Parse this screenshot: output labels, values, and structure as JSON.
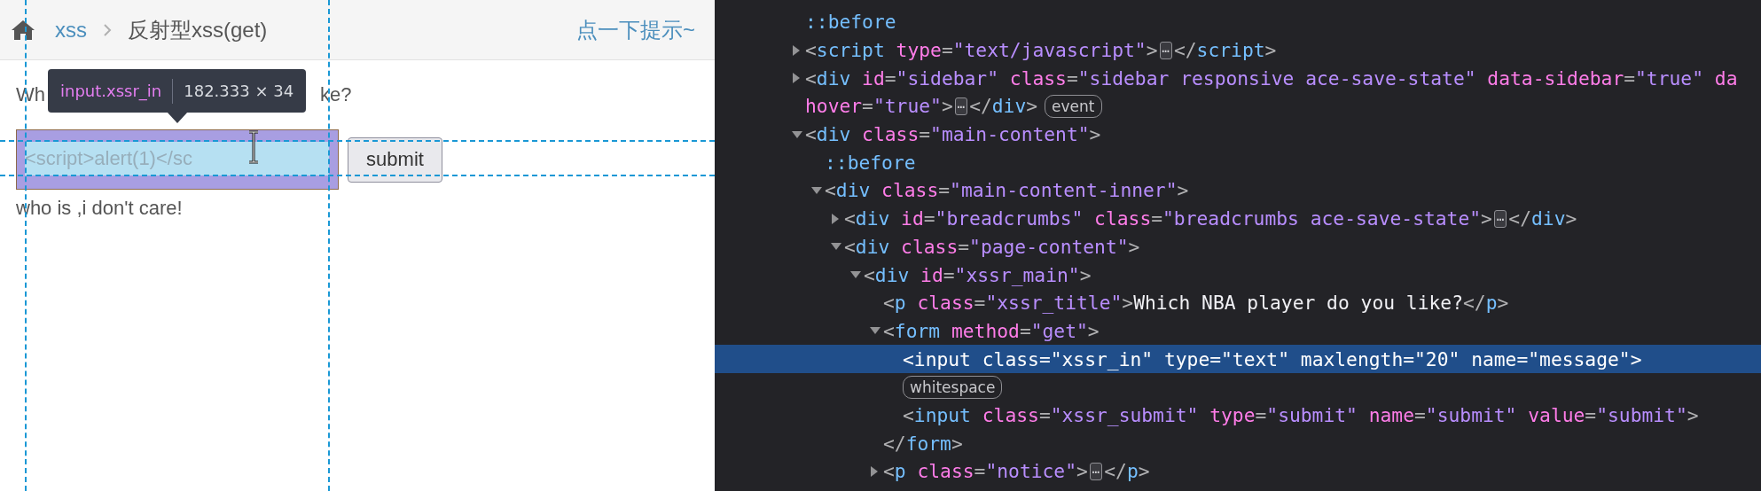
{
  "breadcrumbs": {
    "items": [
      {
        "kind": "link",
        "text": "xss"
      },
      {
        "kind": "current",
        "text": "反射型xss(get)"
      }
    ],
    "hint_link": "点一下提示~"
  },
  "page": {
    "question_visible": [
      "Wh",
      "ke?"
    ],
    "input_value": "<script>alert(1)</sc",
    "submit_label": "submit",
    "result_text": "who is ,i don't care!"
  },
  "inspector_tooltip": {
    "selector": "input.xssr_in",
    "size": "182.333 × 34"
  },
  "devtools": {
    "nodes": [
      {
        "kind": "pseudo",
        "selected": false,
        "lines": [
          [
            {
              "kind": "pseudo",
              "text": "::before"
            }
          ]
        ]
      },
      {
        "kind": "branch",
        "expanded": false,
        "selected": false,
        "lines": [
          [
            {
              "kind": "punct",
              "text": "<"
            },
            {
              "kind": "tag",
              "text": "script"
            },
            {
              "kind": "attr",
              "text": " type"
            },
            {
              "kind": "punct",
              "text": "="
            },
            {
              "kind": "value",
              "text": "\"text/javascript\""
            },
            {
              "kind": "punct",
              "text": ">"
            },
            {
              "kind": "more",
              "text": "⋯"
            },
            {
              "kind": "punct",
              "text": "</"
            },
            {
              "kind": "tag",
              "text": "script"
            },
            {
              "kind": "punct",
              "text": ">"
            }
          ]
        ]
      },
      {
        "kind": "branch",
        "expanded": false,
        "selected": false,
        "lines": [
          [
            {
              "kind": "punct",
              "text": "<"
            },
            {
              "kind": "tag",
              "text": "div"
            },
            {
              "kind": "attr",
              "text": " id"
            },
            {
              "kind": "punct",
              "text": "="
            },
            {
              "kind": "value",
              "text": "\"sidebar\""
            },
            {
              "kind": "attr",
              "text": " class"
            },
            {
              "kind": "punct",
              "text": "="
            },
            {
              "kind": "value",
              "text": "\"sidebar responsive ace-save-state\""
            },
            {
              "kind": "attr",
              "text": " data-sidebar"
            },
            {
              "kind": "punct",
              "text": "="
            },
            {
              "kind": "value",
              "text": "\"true\""
            },
            {
              "kind": "attr",
              "text": " da"
            }
          ],
          [
            {
              "kind": "attr",
              "text": "hover"
            },
            {
              "kind": "punct",
              "text": "="
            },
            {
              "kind": "value",
              "text": "\"true\""
            },
            {
              "kind": "punct",
              "text": ">"
            },
            {
              "kind": "more",
              "text": "⋯"
            },
            {
              "kind": "punct",
              "text": "</"
            },
            {
              "kind": "tag",
              "text": "div"
            },
            {
              "kind": "punct",
              "text": ">"
            },
            {
              "kind": "badge",
              "text": "event"
            }
          ]
        ]
      },
      {
        "kind": "branch",
        "expanded": true,
        "selected": false,
        "lines": [
          [
            {
              "kind": "punct",
              "text": "<"
            },
            {
              "kind": "tag",
              "text": "div"
            },
            {
              "kind": "attr",
              "text": " class"
            },
            {
              "kind": "punct",
              "text": "="
            },
            {
              "kind": "value",
              "text": "\"main-content\""
            },
            {
              "kind": "punct",
              "text": ">"
            }
          ]
        ],
        "children": [
          {
            "kind": "pseudo",
            "selected": false,
            "lines": [
              [
                {
                  "kind": "pseudo",
                  "text": "::before"
                }
              ]
            ]
          },
          {
            "kind": "branch",
            "expanded": true,
            "selected": false,
            "lines": [
              [
                {
                  "kind": "punct",
                  "text": "<"
                },
                {
                  "kind": "tag",
                  "text": "div"
                },
                {
                  "kind": "attr",
                  "text": " class"
                },
                {
                  "kind": "punct",
                  "text": "="
                },
                {
                  "kind": "value",
                  "text": "\"main-content-inner\""
                },
                {
                  "kind": "punct",
                  "text": ">"
                }
              ]
            ],
            "children": [
              {
                "kind": "branch",
                "expanded": false,
                "selected": false,
                "lines": [
                  [
                    {
                      "kind": "punct",
                      "text": "<"
                    },
                    {
                      "kind": "tag",
                      "text": "div"
                    },
                    {
                      "kind": "attr",
                      "text": " id"
                    },
                    {
                      "kind": "punct",
                      "text": "="
                    },
                    {
                      "kind": "value",
                      "text": "\"breadcrumbs\""
                    },
                    {
                      "kind": "attr",
                      "text": " class"
                    },
                    {
                      "kind": "punct",
                      "text": "="
                    },
                    {
                      "kind": "value",
                      "text": "\"breadcrumbs ace-save-state\""
                    },
                    {
                      "kind": "punct",
                      "text": ">"
                    },
                    {
                      "kind": "more",
                      "text": "⋯"
                    },
                    {
                      "kind": "punct",
                      "text": "</"
                    },
                    {
                      "kind": "tag",
                      "text": "div"
                    },
                    {
                      "kind": "punct",
                      "text": ">"
                    }
                  ]
                ]
              },
              {
                "kind": "branch",
                "expanded": true,
                "selected": false,
                "lines": [
                  [
                    {
                      "kind": "punct",
                      "text": "<"
                    },
                    {
                      "kind": "tag",
                      "text": "div"
                    },
                    {
                      "kind": "attr",
                      "text": " class"
                    },
                    {
                      "kind": "punct",
                      "text": "="
                    },
                    {
                      "kind": "value",
                      "text": "\"page-content\""
                    },
                    {
                      "kind": "punct",
                      "text": ">"
                    }
                  ]
                ],
                "children": [
                  {
                    "kind": "branch",
                    "expanded": true,
                    "selected": false,
                    "lines": [
                      [
                        {
                          "kind": "punct",
                          "text": "<"
                        },
                        {
                          "kind": "tag",
                          "text": "div"
                        },
                        {
                          "kind": "attr",
                          "text": " id"
                        },
                        {
                          "kind": "punct",
                          "text": "="
                        },
                        {
                          "kind": "value",
                          "text": "\"xssr_main\""
                        },
                        {
                          "kind": "punct",
                          "text": ">"
                        }
                      ]
                    ],
                    "children": [
                      {
                        "kind": "leaf",
                        "selected": false,
                        "lines": [
                          [
                            {
                              "kind": "punct",
                              "text": "<"
                            },
                            {
                              "kind": "tag",
                              "text": "p"
                            },
                            {
                              "kind": "attr",
                              "text": " class"
                            },
                            {
                              "kind": "punct",
                              "text": "="
                            },
                            {
                              "kind": "value",
                              "text": "\"xssr_title\""
                            },
                            {
                              "kind": "punct",
                              "text": ">"
                            },
                            {
                              "kind": "text",
                              "text": "Which NBA player do you like?"
                            },
                            {
                              "kind": "punct",
                              "text": "</"
                            },
                            {
                              "kind": "tag",
                              "text": "p"
                            },
                            {
                              "kind": "punct",
                              "text": ">"
                            }
                          ]
                        ]
                      },
                      {
                        "kind": "branch",
                        "expanded": true,
                        "selected": false,
                        "lines": [
                          [
                            {
                              "kind": "punct",
                              "text": "<"
                            },
                            {
                              "kind": "tag",
                              "text": "form"
                            },
                            {
                              "kind": "attr",
                              "text": " method"
                            },
                            {
                              "kind": "punct",
                              "text": "="
                            },
                            {
                              "kind": "value",
                              "text": "\"get\""
                            },
                            {
                              "kind": "punct",
                              "text": ">"
                            }
                          ]
                        ],
                        "close": [
                          {
                            "kind": "punct",
                            "text": "</"
                          },
                          {
                            "kind": "tag",
                            "text": "form"
                          },
                          {
                            "kind": "punct",
                            "text": ">"
                          }
                        ],
                        "children": [
                          {
                            "kind": "leaf",
                            "selected": true,
                            "lines": [
                              [
                                {
                                  "kind": "punct",
                                  "text": "<"
                                },
                                {
                                  "kind": "tag",
                                  "text": "input"
                                },
                                {
                                  "kind": "attr",
                                  "text": " class"
                                },
                                {
                                  "kind": "punct",
                                  "text": "="
                                },
                                {
                                  "kind": "value",
                                  "text": "\"xssr_in\""
                                },
                                {
                                  "kind": "attr",
                                  "text": " type"
                                },
                                {
                                  "kind": "punct",
                                  "text": "="
                                },
                                {
                                  "kind": "value",
                                  "text": "\"text\""
                                },
                                {
                                  "kind": "attr",
                                  "text": " maxlength"
                                },
                                {
                                  "kind": "punct",
                                  "text": "="
                                },
                                {
                                  "kind": "value",
                                  "text": "\"20\""
                                },
                                {
                                  "kind": "attr",
                                  "text": " name"
                                },
                                {
                                  "kind": "punct",
                                  "text": "="
                                },
                                {
                                  "kind": "value",
                                  "text": "\"message\""
                                },
                                {
                                  "kind": "punct",
                                  "text": ">"
                                }
                              ]
                            ]
                          },
                          {
                            "kind": "leaf",
                            "selected": false,
                            "lines": [
                              [
                                {
                                  "kind": "badge",
                                  "text": "whitespace"
                                }
                              ]
                            ]
                          },
                          {
                            "kind": "leaf",
                            "selected": false,
                            "lines": [
                              [
                                {
                                  "kind": "punct",
                                  "text": "<"
                                },
                                {
                                  "kind": "tag",
                                  "text": "input"
                                },
                                {
                                  "kind": "attr",
                                  "text": " class"
                                },
                                {
                                  "kind": "punct",
                                  "text": "="
                                },
                                {
                                  "kind": "value",
                                  "text": "\"xssr_submit\""
                                },
                                {
                                  "kind": "attr",
                                  "text": " type"
                                },
                                {
                                  "kind": "punct",
                                  "text": "="
                                },
                                {
                                  "kind": "value",
                                  "text": "\"submit\""
                                },
                                {
                                  "kind": "attr",
                                  "text": " name"
                                },
                                {
                                  "kind": "punct",
                                  "text": "="
                                },
                                {
                                  "kind": "value",
                                  "text": "\"submit\""
                                },
                                {
                                  "kind": "attr",
                                  "text": " value"
                                },
                                {
                                  "kind": "punct",
                                  "text": "="
                                },
                                {
                                  "kind": "value",
                                  "text": "\"submit\""
                                },
                                {
                                  "kind": "punct",
                                  "text": ">"
                                }
                              ]
                            ]
                          }
                        ]
                      },
                      {
                        "kind": "branch",
                        "expanded": false,
                        "selected": false,
                        "lines": [
                          [
                            {
                              "kind": "punct",
                              "text": "<"
                            },
                            {
                              "kind": "tag",
                              "text": "p"
                            },
                            {
                              "kind": "attr",
                              "text": " class"
                            },
                            {
                              "kind": "punct",
                              "text": "="
                            },
                            {
                              "kind": "value",
                              "text": "\"notice\""
                            },
                            {
                              "kind": "punct",
                              "text": ">"
                            },
                            {
                              "kind": "more",
                              "text": "⋯"
                            },
                            {
                              "kind": "punct",
                              "text": "</"
                            },
                            {
                              "kind": "tag",
                              "text": "p"
                            },
                            {
                              "kind": "punct",
                              "text": ">"
                            }
                          ]
                        ]
                      }
                    ]
                  }
                ]
              }
            ]
          }
        ]
      }
    ]
  }
}
